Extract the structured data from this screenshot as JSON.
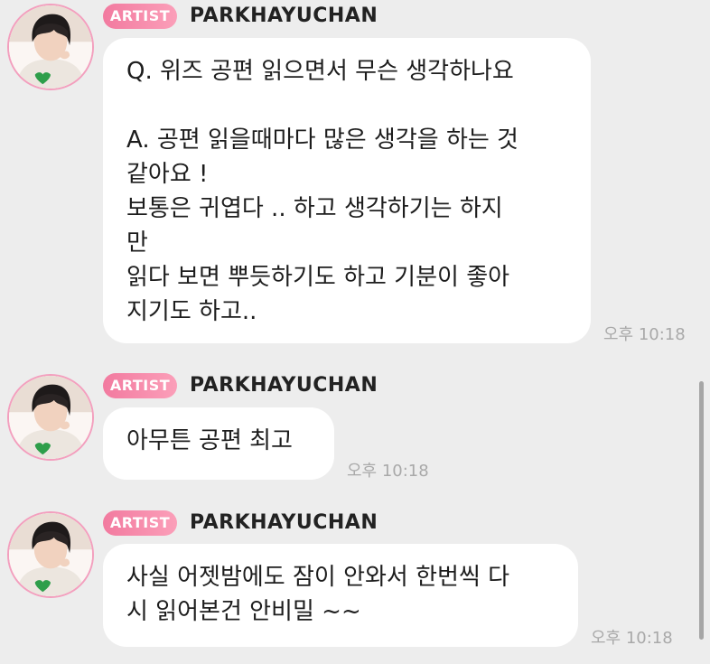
{
  "messages": [
    {
      "badge": "ARTIST",
      "sender": "PARKHAYUCHAN",
      "text": "Q. 위즈 공편 읽으면서 무슨 생각하나요\n\nA. 공편 읽을때마다 많은 생각을 하는 것\n같아요 !\n보통은 귀엽다 .. 하고 생각하기는 하지\n만\n읽다 보면 뿌듯하기도 하고 기분이 좋아\n지기도 하고..",
      "time": "오후 10:18"
    },
    {
      "badge": "ARTIST",
      "sender": "PARKHAYUCHAN",
      "text": "아무튼 공편 최고",
      "time": "오후 10:18"
    },
    {
      "badge": "ARTIST",
      "sender": "PARKHAYUCHAN",
      "text": "사실 어젯밤에도 잠이 안와서 한번씩 다\n시 읽어본건 안비밀 ~~",
      "time": "오후 10:18"
    }
  ],
  "colors": {
    "background": "#ededed",
    "bubble": "#ffffff",
    "badge_start": "#f27a9f",
    "badge_end": "#fb9fb9",
    "avatar_ring": "#f39fbe",
    "heart": "#2e9e4a",
    "time_text": "#a9a9a9"
  },
  "icons": {
    "avatar": "profile-photo",
    "avatar_overlay": "green-heart-icon"
  }
}
